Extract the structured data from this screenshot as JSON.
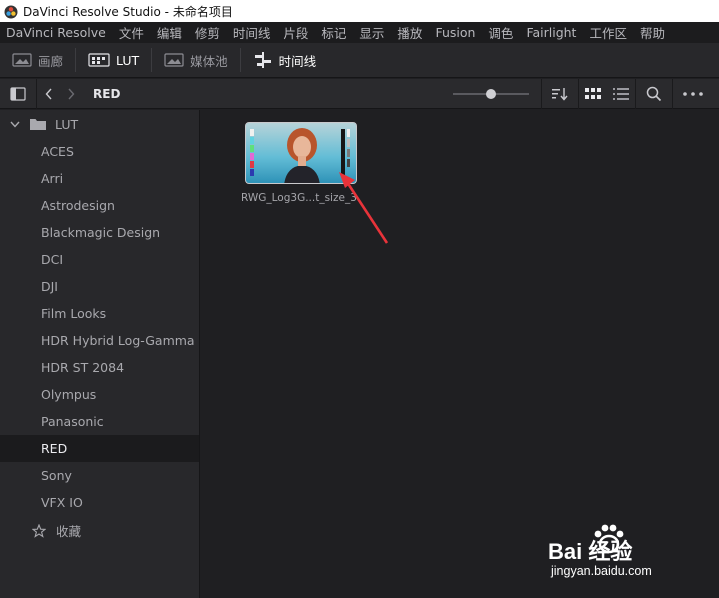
{
  "window": {
    "title": "DaVinci Resolve Studio - 未命名项目"
  },
  "menu": {
    "items": [
      "DaVinci Resolve",
      "文件",
      "编辑",
      "修剪",
      "时间线",
      "片段",
      "标记",
      "显示",
      "播放",
      "Fusion",
      "调色",
      "Fairlight",
      "工作区",
      "帮助"
    ]
  },
  "toolbar": {
    "gallery_label": "画廊",
    "lut_label": "LUT",
    "media_pool_label": "媒体池",
    "timeline_label": "时间线"
  },
  "pathbar": {
    "current_folder": "RED"
  },
  "sidebar": {
    "root_label": "LUT",
    "items": [
      {
        "label": "ACES"
      },
      {
        "label": "Arri"
      },
      {
        "label": "Astrodesign"
      },
      {
        "label": "Blackmagic Design"
      },
      {
        "label": "DCI"
      },
      {
        "label": "DJI"
      },
      {
        "label": "Film Looks"
      },
      {
        "label": "HDR Hybrid Log-Gamma"
      },
      {
        "label": "HDR ST 2084"
      },
      {
        "label": "Olympus"
      },
      {
        "label": "Panasonic"
      },
      {
        "label": "RED",
        "selected": true
      },
      {
        "label": "Sony"
      },
      {
        "label": "VFX IO"
      }
    ],
    "favorites_label": "收藏"
  },
  "content": {
    "clips": [
      {
        "name": "RWG_Log3G...t_size_3"
      }
    ]
  },
  "watermark": {
    "logo": "Bai 经验",
    "site": "jingyan.baidu.com"
  },
  "colors": {
    "accent_arrow": "#e8333a",
    "background": "#1f1f22",
    "sidebar": "#28282b"
  }
}
